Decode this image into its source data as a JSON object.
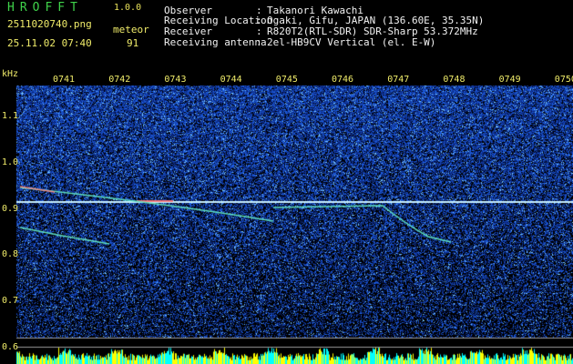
{
  "header": {
    "app_title": "HROFFT",
    "version": "1.0.0",
    "filename": "2511020740.png",
    "meteor_label": "meteor",
    "datetime": "25.11.02 07:40",
    "meteor_count": "91",
    "info": [
      {
        "label": "Observer",
        "value": "Takanori Kawachi"
      },
      {
        "label": "Receiving Location",
        "value": "Ogaki, Gifu, JAPAN (136.60E, 35.35N)"
      },
      {
        "label": "Receiver",
        "value": "R820T2(RTL-SDR) SDR-Sharp 53.372MHz"
      },
      {
        "label": "Receiving antenna",
        "value": "2el-HB9CV Vertical (el. E-W)"
      }
    ]
  },
  "plot": {
    "unit_label": "kHz",
    "time_labels": [
      "0741",
      "0742",
      "0743",
      "0744",
      "0745",
      "0746",
      "0747",
      "0748",
      "0749",
      "0750"
    ],
    "freq_labels": [
      {
        "value": 1.1,
        "text": "1.1"
      },
      {
        "value": 1.0,
        "text": "1.0"
      },
      {
        "value": 0.9,
        "text": "0.9"
      },
      {
        "value": 0.8,
        "text": "0.8"
      },
      {
        "value": 0.7,
        "text": "0.7"
      },
      {
        "value": 0.6,
        "text": "0.6"
      }
    ],
    "carrier_freq": 0.915,
    "colors": {
      "background": "#000000",
      "noise_dark": "#0a1a6a",
      "noise_bright": "#3a7aff",
      "carrier": "#c8f0ff",
      "meteor_trail": "#5fe0c0",
      "axis_text": "#f0ec6a",
      "level_yellow": "#ffff00",
      "level_cyan": "#00ffff"
    }
  }
}
